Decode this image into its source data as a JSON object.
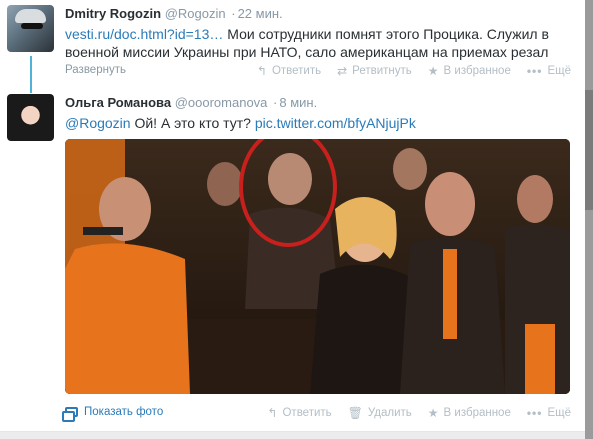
{
  "tweets": [
    {
      "fullname": "Dmitry Rogozin",
      "username": "@Rogozin",
      "timestamp": "22 мин.",
      "link_text": "vesti.ru/doc.html?id=13…",
      "text": " Мои сотрудники помнят этого Процика. Служил в военной миссии Украины при НАТО, сало американцам на приемах резал",
      "expand_label": "Развернуть",
      "actions": [
        {
          "icon": "reply-icon",
          "label": "Ответить"
        },
        {
          "icon": "retweet-icon",
          "label": "Ретвитнуть"
        },
        {
          "icon": "favorite-star-icon",
          "label": "В избранное"
        },
        {
          "icon": "more-dots-icon",
          "label": "Ещё"
        }
      ]
    },
    {
      "fullname": "Ольга Романова",
      "username": "@oooromanova",
      "timestamp": "8 мин.",
      "mention": "@Rogozin",
      "text": " Ой! А это кто тут? ",
      "link_text": "pic.twitter.com/bfyANjujPk",
      "show_photo_label": "Показать фото",
      "actions": [
        {
          "icon": "reply-icon",
          "label": "Ответить"
        },
        {
          "icon": "delete-trash-icon",
          "label": "Удалить"
        },
        {
          "icon": "favorite-star-icon",
          "label": "В избранное"
        },
        {
          "icon": "more-dots-icon",
          "label": "Ещё"
        }
      ]
    }
  ],
  "colors": {
    "link": "#2b7bb9",
    "meta": "#8899a6",
    "thread_line": "#4fb3d8",
    "highlight_circle": "#c8201c",
    "jacket_orange": "#e7731c"
  }
}
